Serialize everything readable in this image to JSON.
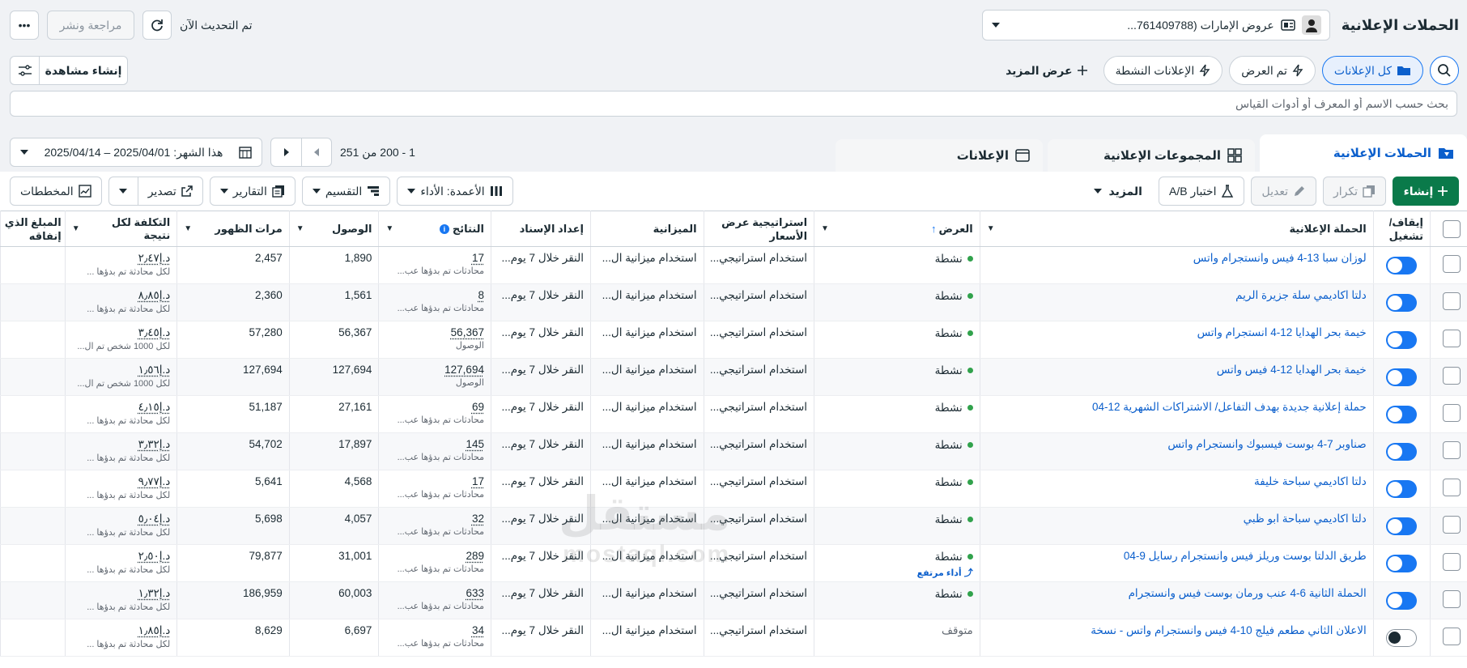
{
  "header": {
    "title": "الحملات الإعلانية",
    "account": "عروض الإمارات (761409788...",
    "update_status": "تم التحديث الآن",
    "review_label": "مراجعة ونشر",
    "more_glyph": "•••"
  },
  "filters": {
    "all_ads": "كل الإعلانات",
    "shown": "تم العرض",
    "active_ads": "الإعلانات النشطة",
    "show_more": "عرض المزيد",
    "create_view": "إنشاء مشاهدة"
  },
  "search": {
    "placeholder": "بحث حسب الاسم أو المعرف أو أدوات القياس"
  },
  "tabs": {
    "campaigns": "الحملات الإعلانية",
    "adsets": "المجموعات الإعلانية",
    "ads": "الإعلانات"
  },
  "pager": {
    "range": "1 - 200 من 251",
    "date": "هذا الشهر: 2025/04/01 – 2025/04/14"
  },
  "toolbar": {
    "create": "إنشاء",
    "duplicate": "تكرار",
    "edit": "تعديل",
    "ab_test": "اختبار A/B",
    "more": "المزيد",
    "columns": "الأعمدة: الأداء",
    "breakdown": "التقسيم",
    "reports": "التقارير",
    "export": "تصدير",
    "charts": "المخططات"
  },
  "columns": {
    "toggle": "إيقاف/ تشغيل",
    "campaign": "الحملة الإعلانية",
    "delivery": "العرض",
    "bid": "استراتيجية عرض الأسعار",
    "budget": "الميزانية",
    "attribution": "إعداد الإسناد",
    "results": "النتائج",
    "reach": "الوصول",
    "impressions": "مرات الظهور",
    "cost": "التكلفة لكل نتيجة",
    "spent": "المبلغ الذي إنفاقه"
  },
  "rows": [
    {
      "on": true,
      "name": "لوزان سبا 13-4 فيس وانستجرام واتس",
      "status": "نشطة",
      "bid": "استخدام استراتيجي...",
      "budget": "استخدام ميزانية ال...",
      "attr": "النقر خلال 7 يوم...",
      "results": "17",
      "results_sub": "محادثات تم بدؤها عب...",
      "reach": "1,890",
      "impr": "2,457",
      "cost": "د.إ٢٫٤٧",
      "cost_sub": "لكل محادثة تم بدؤها ..."
    },
    {
      "on": true,
      "name": "دلتا اكاديمي سلة جزيرة الريم",
      "status": "نشطة",
      "bid": "استخدام استراتيجي...",
      "budget": "استخدام ميزانية ال...",
      "attr": "النقر خلال 7 يوم...",
      "results": "8",
      "results_sub": "محادثات تم بدؤها عب...",
      "reach": "1,561",
      "impr": "2,360",
      "cost": "د.إ٨٫٨٥",
      "cost_sub": "لكل محادثة تم بدؤها ..."
    },
    {
      "on": true,
      "name": "خيمة بحر الهدايا 12-4 انستجرام واتس",
      "status": "نشطة",
      "bid": "استخدام استراتيجي...",
      "budget": "استخدام ميزانية ال...",
      "attr": "النقر خلال 7 يوم...",
      "results": "56,367",
      "results_sub": "الوصول",
      "reach": "56,367",
      "impr": "57,280",
      "cost": "د.إ٣٫٤٥",
      "cost_sub": "لكل 1000 شخص تم ال..."
    },
    {
      "on": true,
      "name": "خيمة بحر الهدايا 12-4 فيس واتس",
      "status": "نشطة",
      "bid": "استخدام استراتيجي...",
      "budget": "استخدام ميزانية ال...",
      "attr": "النقر خلال 7 يوم...",
      "results": "127,694",
      "results_sub": "الوصول",
      "reach": "127,694",
      "impr": "127,694",
      "cost": "د.إ١٫٥٦",
      "cost_sub": "لكل 1000 شخص تم ال..."
    },
    {
      "on": true,
      "name": "حملة إعلانية جديدة بهدف التفاعل/ الاشتراكات الشهرية 12-04",
      "status": "نشطة",
      "bid": "استخدام استراتيجي...",
      "budget": "استخدام ميزانية ال...",
      "attr": "النقر خلال 7 يوم...",
      "results": "69",
      "results_sub": "محادثات تم بدؤها عب...",
      "reach": "27,161",
      "impr": "51,187",
      "cost": "د.إ٤٫١٥",
      "cost_sub": "لكل محادثة تم بدؤها ..."
    },
    {
      "on": true,
      "name": "صناوبر 7-4 بوست فيسبوك وانستجرام واتس",
      "status": "نشطة",
      "bid": "استخدام استراتيجي...",
      "budget": "استخدام ميزانية ال...",
      "attr": "النقر خلال 7 يوم...",
      "results": "145",
      "results_sub": "محادثات تم بدؤها عب...",
      "reach": "17,897",
      "impr": "54,702",
      "cost": "د.إ٣٫٣٢",
      "cost_sub": "لكل محادثة تم بدؤها ..."
    },
    {
      "on": true,
      "name": "دلتا اكاديمي سباحة خليفة",
      "status": "نشطة",
      "bid": "استخدام استراتيجي...",
      "budget": "استخدام ميزانية ال...",
      "attr": "النقر خلال 7 يوم...",
      "results": "17",
      "results_sub": "محادثات تم بدؤها عب...",
      "reach": "4,568",
      "impr": "5,641",
      "cost": "د.إ٩٫٧٧",
      "cost_sub": "لكل محادثة تم بدؤها ..."
    },
    {
      "on": true,
      "name": "دلتا اكاديمي سباحة ابو ظبي",
      "status": "نشطة",
      "bid": "استخدام استراتيجي...",
      "budget": "استخدام ميزانية ال...",
      "attr": "النقر خلال 7 يوم...",
      "results": "32",
      "results_sub": "محادثات تم بدؤها عب...",
      "reach": "4,057",
      "impr": "5,698",
      "cost": "د.إ٥٫٠٤",
      "cost_sub": "لكل محادثة تم بدؤها ..."
    },
    {
      "on": true,
      "name": "طريق الدلتا بوست وريلز فيس وانستجرام رسايل 9-04",
      "status": "نشطة",
      "badge": "أداء مرتفع",
      "bid": "استخدام استراتيجي...",
      "budget": "استخدام ميزانية ال...",
      "attr": "النقر خلال 7 يوم...",
      "results": "289",
      "results_sub": "محادثات تم بدؤها عب...",
      "reach": "31,001",
      "impr": "79,877",
      "cost": "د.إ٢٫٥٠",
      "cost_sub": "لكل محادثة تم بدؤها ..."
    },
    {
      "on": true,
      "name": "الحملة الثانية 6-4 عنب ورمان بوست فيس وانستجرام",
      "status": "نشطة",
      "bid": "استخدام استراتيجي...",
      "budget": "استخدام ميزانية ال...",
      "attr": "النقر خلال 7 يوم...",
      "results": "633",
      "results_sub": "محادثات تم بدؤها عب...",
      "reach": "60,003",
      "impr": "186,959",
      "cost": "د.إ١٫٣٢",
      "cost_sub": "لكل محادثة تم بدؤها ..."
    },
    {
      "on": false,
      "name": "الاعلان الثاني مطعم فيلج 10-4 فيس وانستجرام واتس - نسخة",
      "status": "متوقف",
      "bid": "استخدام استراتيجي...",
      "budget": "استخدام ميزانية ال...",
      "attr": "النقر خلال 7 يوم...",
      "results": "34",
      "results_sub": "محادثات تم بدؤها عب...",
      "reach": "6,697",
      "impr": "8,629",
      "cost": "د.إ١٫٨٥",
      "cost_sub": "لكل محادثة تم بدؤها ..."
    }
  ],
  "watermark": {
    "ar": "مستقل",
    "en": "mostaql.com"
  }
}
